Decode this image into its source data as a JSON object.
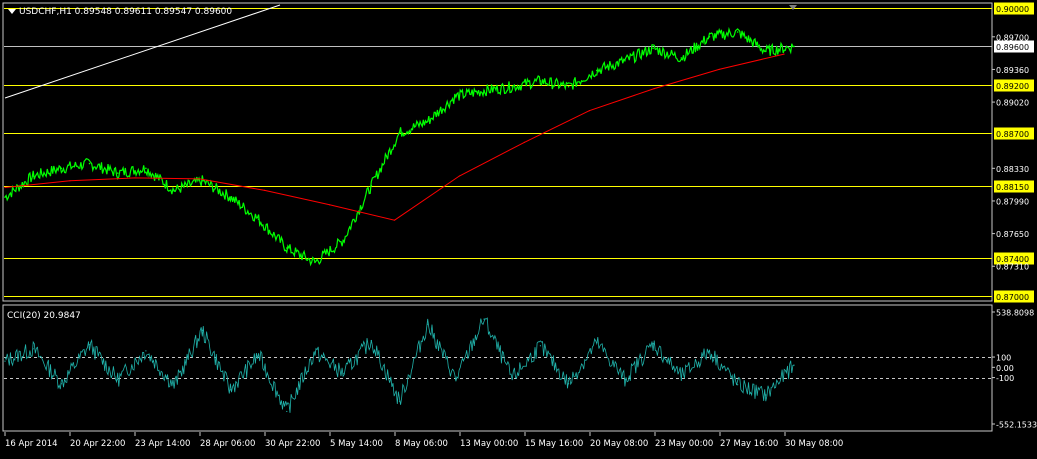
{
  "colors": {
    "background": "#000000",
    "frame": "#c8c8c8",
    "price_series": "#00ff00",
    "moving_average": "#ff0000",
    "cci_series": "#20b2aa",
    "level_line": "#ffff00",
    "level_label_bg": "#ffff00",
    "trend_line": "#ffffff",
    "current_price_line": "#c0c0c0",
    "text": "#ffffff"
  },
  "header": {
    "title": "USDCHF,H1  0.89548 0.89611 0.89547 0.89600",
    "menu_icon": "triangle-down-icon"
  },
  "chart_data": [
    {
      "type": "line",
      "symbol": "USDCHF",
      "timeframe": "H1",
      "title": "USDCHF,H1  0.89548 0.89611 0.89547 0.89600",
      "ohlc_last": {
        "open": 0.89548,
        "high": 0.89611,
        "low": 0.89547,
        "close": 0.896
      },
      "ylim": [
        0.87,
        0.9
      ],
      "y_ticks": [
        "0.90000",
        "0.89700",
        "0.89360",
        "0.89020",
        "0.88330",
        "0.87990",
        "0.87650",
        "0.87310"
      ],
      "x_ticks": [
        "16 Apr 2014",
        "20 Apr 22:00",
        "23 Apr 14:00",
        "28 Apr 06:00",
        "30 Apr 22:00",
        "5 May 14:00",
        "8 May 06:00",
        "13 May 00:00",
        "15 May 16:00",
        "20 May 08:00",
        "23 May 00:00",
        "27 May 16:00",
        "30 May 08:00"
      ],
      "horizontal_levels": [
        "0.90000",
        "0.89200",
        "0.88700",
        "0.88150",
        "0.87400",
        "0.87000"
      ],
      "current_price": "0.89600",
      "series": [
        {
          "name": "Close",
          "x": [
            "16 Apr 2014",
            "18 Apr",
            "20 Apr 22:00",
            "22 Apr",
            "23 Apr 14:00",
            "25 Apr",
            "28 Apr 06:00",
            "29 Apr",
            "30 Apr 22:00",
            "2 May",
            "5 May 14:00",
            "6 May",
            "8 May 06:00",
            "9 May",
            "12 May",
            "13 May 00:00",
            "14 May",
            "15 May 16:00",
            "16 May",
            "19 May",
            "20 May 08:00",
            "21 May",
            "22 May",
            "23 May 00:00",
            "26 May",
            "27 May 16:00",
            "28 May",
            "29 May",
            "30 May 08:00"
          ],
          "values": [
            0.8803,
            0.8825,
            0.8833,
            0.8838,
            0.8828,
            0.8833,
            0.881,
            0.882,
            0.8803,
            0.878,
            0.875,
            0.8735,
            0.8758,
            0.8815,
            0.887,
            0.8882,
            0.8908,
            0.8914,
            0.8918,
            0.8924,
            0.8918,
            0.8935,
            0.8945,
            0.8958,
            0.8948,
            0.897,
            0.8975,
            0.8955,
            0.896
          ]
        },
        {
          "name": "Moving Average",
          "x": [
            "16 Apr 2014",
            "20 Apr 22:00",
            "23 Apr 14:00",
            "28 Apr 06:00",
            "30 Apr 22:00",
            "5 May 14:00",
            "8 May 06:00",
            "13 May 00:00",
            "15 May 16:00",
            "20 May 08:00",
            "23 May 00:00",
            "27 May 16:00",
            "30 May 08:00"
          ],
          "values": [
            0.8813,
            0.882,
            0.8823,
            0.8822,
            0.881,
            0.8795,
            0.8779,
            0.8825,
            0.886,
            0.8893,
            0.8916,
            0.8936,
            0.8952
          ]
        }
      ]
    },
    {
      "type": "line",
      "title": "CCI(20) 20.9847",
      "ylim": [
        -552.1533,
        538.8098
      ],
      "y_ticks": [
        "538.8098",
        "100",
        "0.00",
        "-100",
        "-552.1533"
      ],
      "horizontal_levels": [
        100,
        -100
      ],
      "series": [
        {
          "name": "CCI(20)",
          "x": [
            "16 Apr 2014",
            "18 Apr",
            "20 Apr 22:00",
            "22 Apr",
            "23 Apr 14:00",
            "25 Apr",
            "28 Apr 06:00",
            "29 Apr",
            "30 Apr 22:00",
            "2 May",
            "5 May 14:00",
            "6 May",
            "8 May 06:00",
            "9 May",
            "12 May",
            "13 May 00:00",
            "14 May",
            "15 May 16:00",
            "16 May",
            "19 May",
            "20 May 08:00",
            "21 May",
            "22 May",
            "23 May 00:00",
            "26 May",
            "27 May 16:00",
            "28 May",
            "29 May",
            "30 May 08:00"
          ],
          "values": [
            60,
            180,
            -160,
            220,
            -120,
            160,
            -180,
            360,
            -220,
            120,
            -430,
            150,
            -60,
            260,
            -330,
            420,
            -120,
            470,
            -110,
            210,
            -160,
            240,
            -120,
            230,
            -90,
            160,
            -170,
            -270,
            21
          ]
        }
      ]
    }
  ]
}
